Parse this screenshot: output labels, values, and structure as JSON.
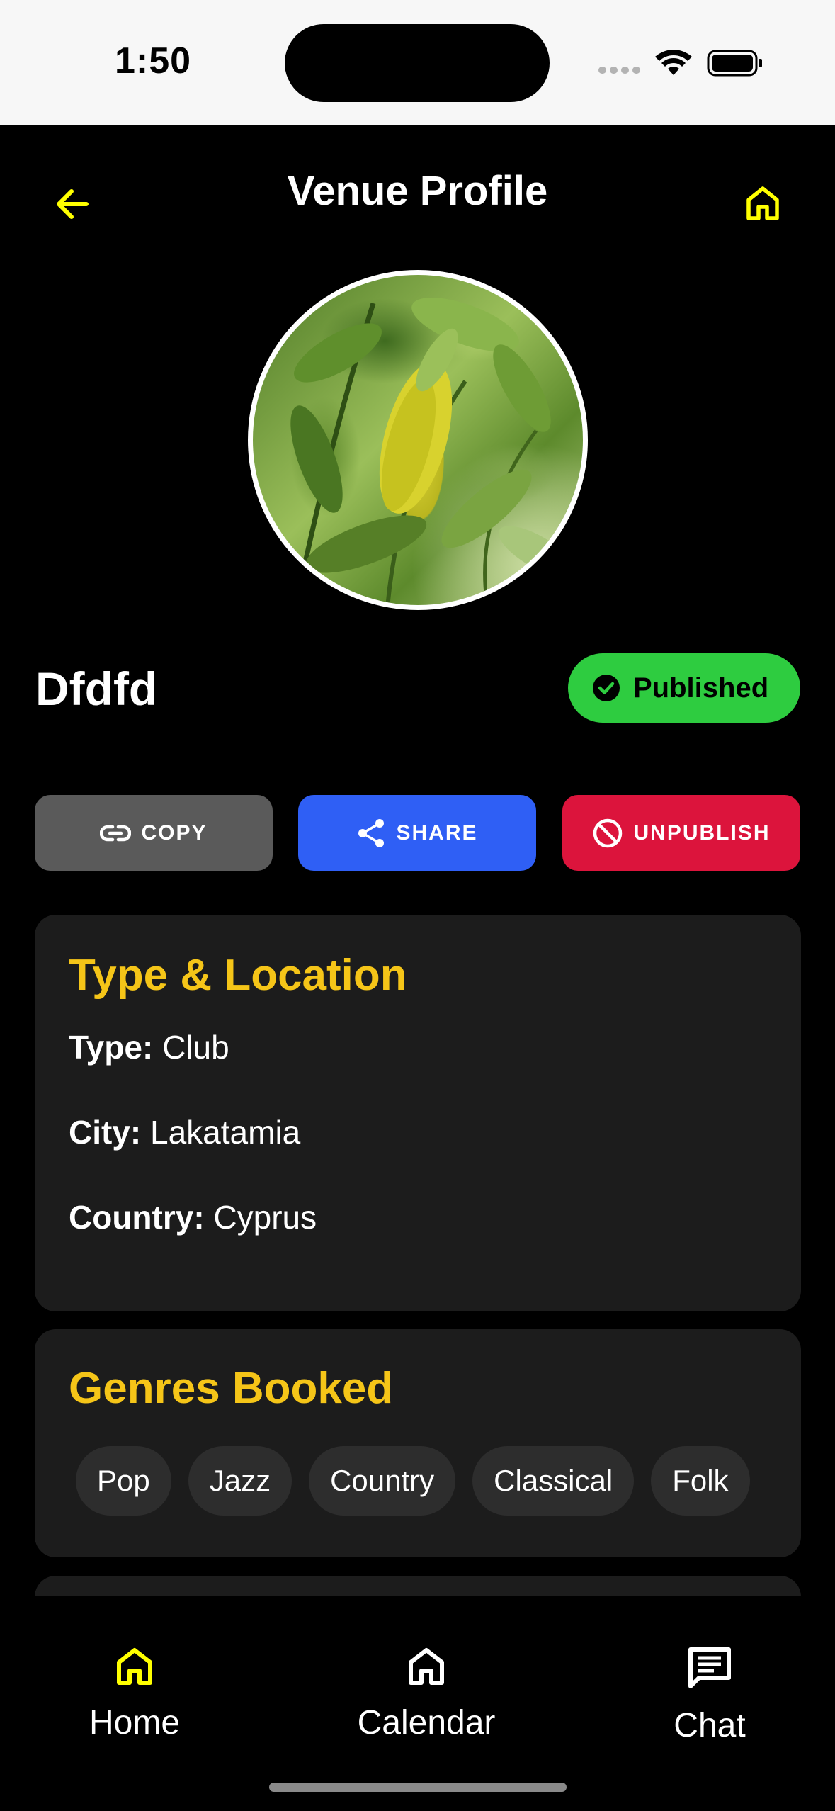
{
  "status_bar": {
    "time": "1:50"
  },
  "header": {
    "title": "Venue Profile",
    "back_icon": "arrow-left-icon",
    "home_icon": "home-icon"
  },
  "venue": {
    "name": "Dfdfd",
    "status": "Published",
    "avatar": "plant-leaves-photo"
  },
  "actions": {
    "copy": "COPY",
    "share": "SHARE",
    "unpublish": "UNPUBLISH"
  },
  "type_location": {
    "title": "Type & Location",
    "type_label": "Type:",
    "type_value": "Club",
    "city_label": "City:",
    "city_value": "Lakatamia",
    "country_label": "Country:",
    "country_value": "Cyprus"
  },
  "genres": {
    "title": "Genres Booked",
    "items": [
      "Pop",
      "Jazz",
      "Country",
      "Classical",
      "Folk"
    ]
  },
  "nav": {
    "items": [
      {
        "label": "Home",
        "icon": "home-icon",
        "active": true
      },
      {
        "label": "Calendar",
        "icon": "home-icon",
        "active": false
      },
      {
        "label": "Chat",
        "icon": "chat-icon",
        "active": false
      }
    ]
  },
  "colors": {
    "accent": "#f5c518",
    "nav_active": "#ffff00",
    "published": "#2ecc40",
    "share": "#2f5ff5",
    "unpublish": "#dc143c",
    "copy": "#5a5a5a",
    "card": "#1c1c1c"
  }
}
